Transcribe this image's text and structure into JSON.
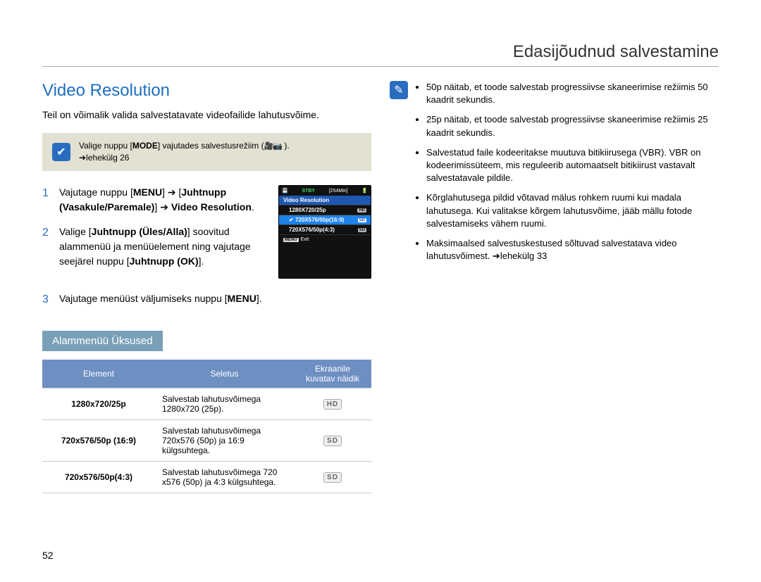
{
  "chapter": "Edasijõudnud salvestamine",
  "title": "Video Resolution",
  "intro": "Teil on võimalik valida salvestatavate videofailide lahutusvõime.",
  "topnote": {
    "pre": "Valige nuppu [",
    "mode": "MODE",
    "post": "] vajutades salvestusrežiim (",
    "icons": "🎥📷",
    "end": " ).",
    "page": "➔lehekülg 26"
  },
  "steps": {
    "s1_a": "Vajutage nuppu [",
    "s1_menu": "MENU",
    "s1_b": "] ➔ [",
    "s1_jog": "Juhtnupp (Vasakule/Paremale)",
    "s1_c": "] ➔ ",
    "s1_vr": "Video Resolution",
    "s1_d": ".",
    "s2_a": "Valige [",
    "s2_b": "Juhtnupp (Üles/Alla)",
    "s2_c": "] soovitud alammenüü ja menüüelement ning vajutage seejärel nuppu [",
    "s2_ok": "Juhtnupp (OK)",
    "s2_d": "].",
    "s3_a": "Vajutage menüüst väljumiseks nuppu [",
    "s3_menu": "MENU",
    "s3_b": "]."
  },
  "cam": {
    "stby": "STBY",
    "time": "[254Min]",
    "heading": "Video Resolution",
    "row1": "1280X720/25p",
    "row1_tag": "HD",
    "row2": "720X576/50p(16:9)",
    "row2_tag": "SD",
    "row3": "720X576/50p(4:3)",
    "row3_tag": "SD",
    "menu_btn": "MENU",
    "exit": "Exit"
  },
  "submenu_heading": "Alammenüü Üksused",
  "th": {
    "el": "Element",
    "desc": "Seletus",
    "ind": "Ekraanile kuvatav näidik"
  },
  "rows": [
    {
      "el": "1280x720/25p",
      "desc": "Salvestab lahutusvõimega 1280x720 (25p).",
      "ind": "HD"
    },
    {
      "el": "720x576/50p (16:9)",
      "desc": "Salvestab lahutusvõimega 720x576 (50p) ja 16:9 külgsuhtega.",
      "ind": "SD"
    },
    {
      "el": "720x576/50p(4:3)",
      "desc": "Salvestab lahutusvõimega 720 x576 (50p) ja 4:3 külgsuhtega.",
      "ind": "SD"
    }
  ],
  "bullets": [
    "50p näitab, et toode salvestab progressiivse skaneerimise režiimis 50 kaadrit sekundis.",
    "25p näitab, et toode salvestab progressiivse skaneerimise režiimis 25 kaadrit sekundis.",
    "Salvestatud faile kodeeritakse muutuva bitikiirusega (VBR). VBR on kodeerimissüteem, mis reguleerib automaatselt bitikiirust vastavalt salvestatavale pildile.",
    "Kõrglahutusega pildid võtavad mälus rohkem ruumi kui madala lahutusega. Kui valitakse kõrgem lahutusvõime, jääb mällu fotode salvestamiseks vähem ruumi.",
    "Maksimaalsed salvestuskestused sõltuvad salvestatava video lahutusvõimest. ➔lehekülg 33"
  ],
  "pagenum": "52"
}
